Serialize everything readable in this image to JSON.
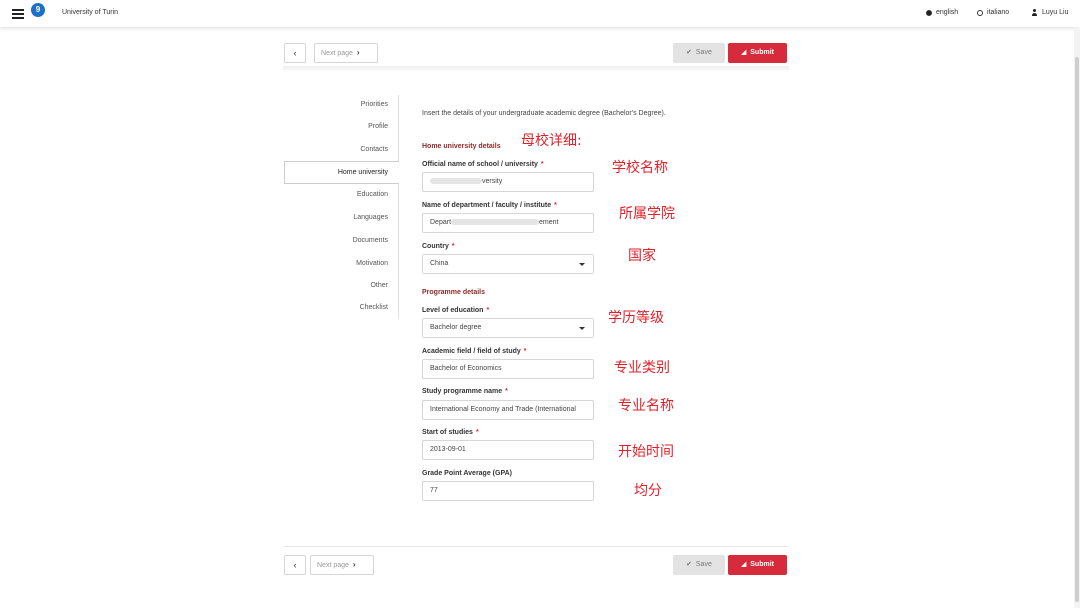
{
  "header": {
    "notification_count": "9",
    "brand": "University of Turin",
    "languages": [
      {
        "label": "english",
        "selected": true
      },
      {
        "label": "italiano",
        "selected": false
      }
    ],
    "user": "Luyu Liu"
  },
  "nav": {
    "prev_icon": "‹",
    "next_label": "Next page",
    "next_icon": "›",
    "save_label": "Save",
    "save_icon": "✔",
    "submit_label": "Submit",
    "submit_icon": "◢"
  },
  "sidebar": {
    "items": [
      "Priorities",
      "Profile",
      "Contacts",
      "Home university",
      "Education",
      "Languages",
      "Documents",
      "Motivation",
      "Other",
      "Checklist"
    ],
    "active": "Home university"
  },
  "form": {
    "intro": "Insert the details of your undergraduate academic degree (Bachelor's Degree).",
    "home_section": "Home university details",
    "programme_section": "Programme details",
    "required_mark": "*",
    "fields": {
      "school_name": {
        "label": "Official name of school / university",
        "value_suffix": "versity",
        "required": true
      },
      "department": {
        "label": "Name of department / faculty / institute",
        "value_prefix": "Depart",
        "value_suffix": "ement",
        "required": true
      },
      "country": {
        "label": "Country",
        "value": "China",
        "required": true
      },
      "level": {
        "label": "Level of education",
        "value": "Bachelor degree",
        "required": true
      },
      "field": {
        "label": "Academic field / field of study",
        "value": "Bachelor of Economics",
        "required": true
      },
      "programme": {
        "label": "Study programme name",
        "value": "International Economy and Trade (International",
        "required": true
      },
      "start": {
        "label": "Start of studies",
        "value": "2013-09-01",
        "required": true
      },
      "gpa": {
        "label": "Grade Point Average (GPA)",
        "value": "77",
        "required": false
      }
    }
  },
  "annotations": {
    "home_details": "母校详细:",
    "school": "学校名称",
    "department": "所属学院",
    "country": "国家",
    "level": "学历等级",
    "field": "专业类别",
    "programme": "专业名称",
    "start": "开始时间",
    "gpa": "均分"
  },
  "colors": {
    "accent": "#d52b3a",
    "badge": "#1e6fc8",
    "section": "#8b2a2a",
    "annotation": "#e0212a"
  }
}
